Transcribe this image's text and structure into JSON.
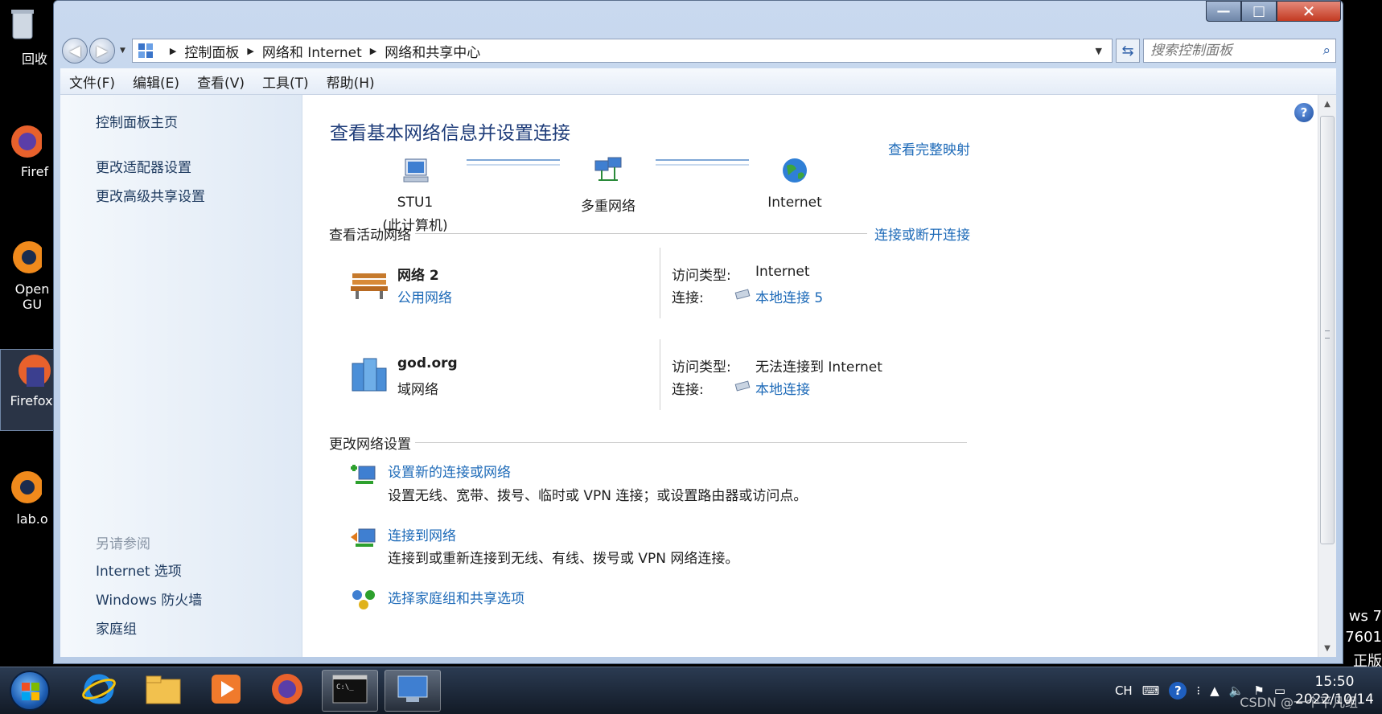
{
  "desktop": {
    "icons": [
      {
        "label": "回收"
      },
      {
        "label": "Firef"
      },
      {
        "label": "Open\nGU"
      },
      {
        "label": "Firefox"
      },
      {
        "label": "lab.o"
      }
    ],
    "right_texts": [
      "ws 7",
      "7601",
      "正版"
    ],
    "watermark": "CSDN @一个平凡组"
  },
  "window": {
    "caption": {
      "minimize": "—",
      "maximize": "□",
      "close": "✕"
    },
    "breadcrumb": [
      "控制面板",
      "网络和 Internet",
      "网络和共享中心"
    ],
    "search_placeholder": "搜索控制面板",
    "menu": [
      "文件(F)",
      "编辑(E)",
      "查看(V)",
      "工具(T)",
      "帮助(H)"
    ]
  },
  "sidebar": {
    "links": [
      "控制面板主页",
      "更改适配器设置",
      "更改高级共享设置"
    ],
    "see_also_heading": "另请参阅",
    "see_also": [
      "Internet 选项",
      "Windows 防火墙",
      "家庭组"
    ]
  },
  "main": {
    "heading": "查看基本网络信息并设置连接",
    "full_map_link": "查看完整映射",
    "nodes": [
      {
        "line1": "STU1",
        "line2": "(此计算机)",
        "icon": "computer-icon"
      },
      {
        "line1": "多重网络",
        "line2": "",
        "icon": "network-icon"
      },
      {
        "line1": "Internet",
        "line2": "",
        "icon": "globe-icon"
      }
    ],
    "active_networks_title": "查看活动网络",
    "connect_disconnect_link": "连接或断开连接",
    "networks": [
      {
        "name": "网络  2",
        "type": "公用网络",
        "type_is_link": true,
        "access_label": "访问类型:",
        "access_value": "Internet",
        "conn_label": "连接:",
        "conn_value": "本地连接 5",
        "icon": "park-bench-icon"
      },
      {
        "name": "god.org",
        "type": "域网络",
        "type_is_link": false,
        "access_label": "访问类型:",
        "access_value": "无法连接到 Internet",
        "conn_label": "连接:",
        "conn_value": "本地连接",
        "icon": "domain-network-icon"
      }
    ],
    "change_settings_title": "更改网络设置",
    "tasks": [
      {
        "title": "设置新的连接或网络",
        "desc": "设置无线、宽带、拨号、临时或 VPN 连接；或设置路由器或访问点。"
      },
      {
        "title": "连接到网络",
        "desc": "连接到或重新连接到无线、有线、拨号或 VPN 网络连接。"
      },
      {
        "title": "选择家庭组和共享选项",
        "desc": ""
      }
    ]
  },
  "taskbar": {
    "tray_lang": "CH",
    "clock_time": "15:50",
    "clock_date": "2022/10/14"
  }
}
